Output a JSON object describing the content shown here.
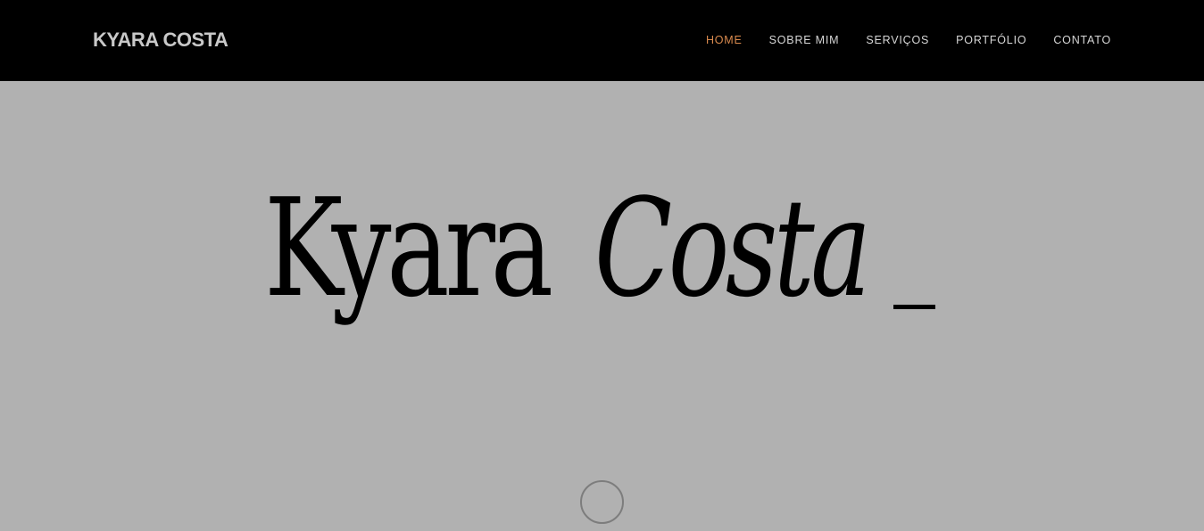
{
  "header": {
    "brand": "KYARA COSTA",
    "nav": [
      {
        "label": "HOME",
        "active": true
      },
      {
        "label": "SOBRE MIM",
        "active": false
      },
      {
        "label": "SERVIÇOS",
        "active": false
      },
      {
        "label": "PORTFÓLIO",
        "active": false
      },
      {
        "label": "CONTATO",
        "active": false
      }
    ]
  },
  "hero": {
    "logo_first": "Kyara",
    "logo_second": "Costa",
    "scroll_icon": "circle-scroll-indicator"
  },
  "colors": {
    "header_bg": "#000000",
    "hero_bg": "#b1b1b1",
    "brand_text": "#c8c8c8",
    "nav_text": "#d6d6d6",
    "nav_active": "#d98a4e",
    "logo_text": "#000000"
  }
}
